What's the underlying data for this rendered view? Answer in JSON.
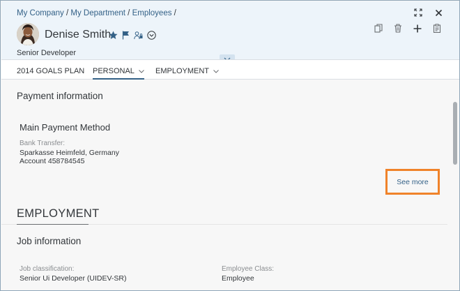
{
  "breadcrumb": {
    "items": [
      "My Company",
      "My Department",
      "Employees"
    ],
    "separator": "/"
  },
  "header": {
    "name": "Denise Smith",
    "subtitle": "Senior Developer",
    "icons": [
      "star-icon",
      "flag-icon",
      "locked-user-icon",
      "chevron-circle-icon"
    ],
    "actions_top": [
      "fullscreen-icon",
      "close-icon"
    ],
    "actions": [
      "copy-icon",
      "delete-icon",
      "add-icon",
      "clipboard-icon"
    ]
  },
  "tabs": [
    {
      "label": "2014 GOALS PLAN",
      "dropdown": false,
      "active": false
    },
    {
      "label": "PERSONAL",
      "dropdown": true,
      "active": true
    },
    {
      "label": "EMPLOYMENT",
      "dropdown": true,
      "active": false
    }
  ],
  "payment": {
    "section_title": "Payment information",
    "method_title": "Main Payment Method",
    "bank_label": "Bank Transfer:",
    "bank_line1": "Sparkasse Heimfeld, Germany",
    "bank_line2": "Account 458784545",
    "see_more": "See more"
  },
  "employment": {
    "heading": "EMPLOYMENT",
    "job_section_title": "Job information",
    "job_class_label": "Job classification:",
    "job_class_value": "Senior Ui Developer (UIDEV-SR)",
    "employee_class_label": "Employee Class:",
    "employee_class_value": "Employee"
  },
  "colors": {
    "header_bg": "#edf4fa",
    "link": "#346187",
    "accent_highlight": "#f0832a",
    "content_bg": "#f7f7f7"
  }
}
